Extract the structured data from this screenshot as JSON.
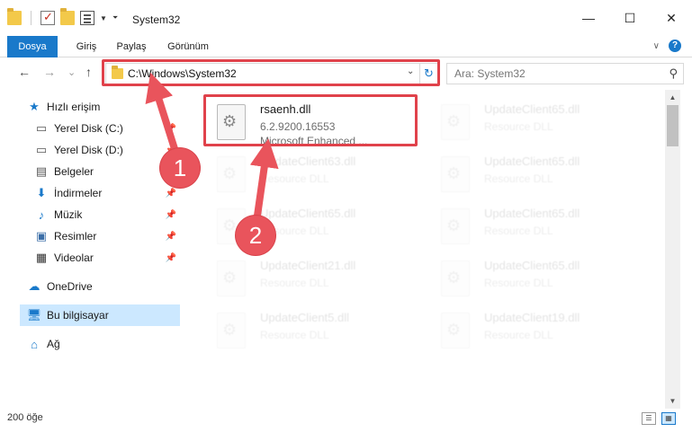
{
  "window": {
    "title": "System32",
    "minimize": "—",
    "maximize": "☐",
    "close": "✕"
  },
  "ribbon": {
    "tabs": [
      "Dosya",
      "Giriş",
      "Paylaş",
      "Görünüm"
    ],
    "help_label": "?"
  },
  "nav": {
    "back": "←",
    "forward": "→",
    "recent": "⌄",
    "up": "↑",
    "address": "C:\\Windows\\System32",
    "refresh": "↻",
    "search_placeholder": "Ara: System32"
  },
  "sidebar": {
    "items": [
      {
        "label": "Hızlı erişim",
        "icon": "star-icon",
        "pinned": false
      },
      {
        "label": "Yerel Disk (C:)",
        "icon": "drive-icon",
        "pinned": true
      },
      {
        "label": "Yerel Disk (D:)",
        "icon": "drive-icon",
        "pinned": true
      },
      {
        "label": "Belgeler",
        "icon": "documents-icon",
        "pinned": true
      },
      {
        "label": "İndirmeler",
        "icon": "download-icon",
        "pinned": true
      },
      {
        "label": "Müzik",
        "icon": "music-icon",
        "pinned": true
      },
      {
        "label": "Resimler",
        "icon": "pictures-icon",
        "pinned": true
      },
      {
        "label": "Videolar",
        "icon": "videos-icon",
        "pinned": true
      },
      {
        "label": "OneDrive",
        "icon": "cloud-icon",
        "pinned": false
      },
      {
        "label": "Bu bilgisayar",
        "icon": "computer-icon",
        "pinned": false
      },
      {
        "label": "Ağ",
        "icon": "network-icon",
        "pinned": false
      }
    ]
  },
  "files": [
    {
      "name": "rsaenh.dll",
      "line1": "6.2.9200.16553",
      "line2": "Microsoft Enhanced ...",
      "highlight": true
    },
    {
      "name": "UpdateClient65.dll",
      "line1": "Resource DLL",
      "line2": ""
    },
    {
      "name": "UpdateClient63.dll",
      "line1": "Resource DLL",
      "line2": ""
    },
    {
      "name": "UpdateClient65.dll",
      "line1": "Resource DLL",
      "line2": ""
    },
    {
      "name": "UpdateClient65.dll",
      "line1": "Resource DLL",
      "line2": ""
    },
    {
      "name": "UpdateClient65.dll",
      "line1": "Resource DLL",
      "line2": ""
    },
    {
      "name": "UpdateClient21.dll",
      "line1": "Resource DLL",
      "line2": ""
    },
    {
      "name": "UpdateClient65.dll",
      "line1": "Resource DLL",
      "line2": ""
    },
    {
      "name": "UpdateClient5.dll",
      "line1": "Resource DLL",
      "line2": ""
    },
    {
      "name": "UpdateClient19.dll",
      "line1": "Resource DLL",
      "line2": ""
    }
  ],
  "status": {
    "item_count": "200 öğe"
  },
  "annotations": {
    "badge1": "1",
    "badge2": "2",
    "color": "#e9545c"
  }
}
